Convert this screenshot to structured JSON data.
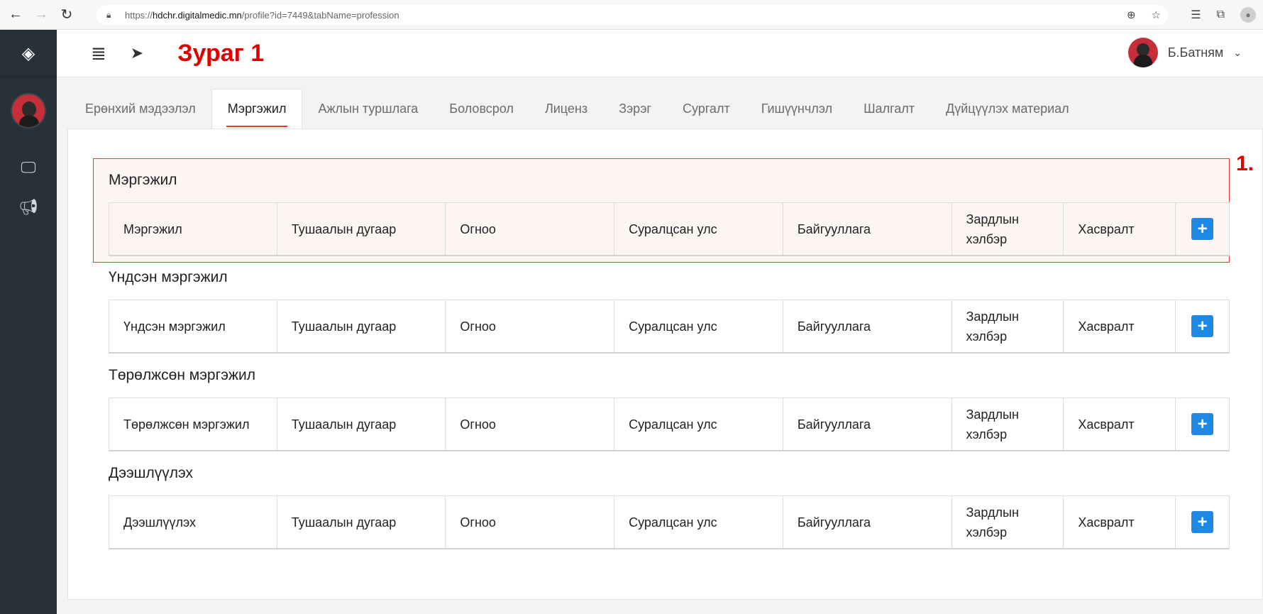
{
  "browser": {
    "url_scheme": "https://",
    "url_host": "hdchr.digitalmedic.mn",
    "url_path": "/profile?id=7449&tabName=profession"
  },
  "header": {
    "figure_title": "Зураг 1",
    "user_name": "Б.Батням"
  },
  "tabs": [
    {
      "label": "Ерөнхий мэдээлэл",
      "active": false
    },
    {
      "label": "Мэргэжил",
      "active": true
    },
    {
      "label": "Ажлын туршлага",
      "active": false
    },
    {
      "label": "Боловсрол",
      "active": false
    },
    {
      "label": "Лиценз",
      "active": false
    },
    {
      "label": "Зэрэг",
      "active": false
    },
    {
      "label": "Сургалт",
      "active": false
    },
    {
      "label": "Гишүүнчлэл",
      "active": false
    },
    {
      "label": "Шалгалт",
      "active": false
    },
    {
      "label": "Дүйцүүлэх материал",
      "active": false
    }
  ],
  "annotation": {
    "number": "1."
  },
  "sections": [
    {
      "title": "Мэргэжил",
      "columns": [
        "Мэргэжил",
        "Тушаалын дугаар",
        "Огноо",
        "Суралцсан улс",
        "Байгууллага",
        "Зардлын хэлбэр",
        "Хасвралт"
      ],
      "add_label": "+"
    },
    {
      "title": "Үндсэн мэргэжил",
      "columns": [
        "Үндсэн мэргэжил",
        "Тушаалын дугаар",
        "Огноо",
        "Суралцсан улс",
        "Байгууллага",
        "Зардлын хэлбэр",
        "Хасвралт"
      ],
      "add_label": "+"
    },
    {
      "title": "Төрөлжсөн мэргэжил",
      "columns": [
        "Төрөлжсөн мэргэжил",
        "Тушаалын дугаар",
        "Огноо",
        "Суралцсан улс",
        "Байгууллага",
        "Зардлын хэлбэр",
        "Хасвралт"
      ],
      "add_label": "+"
    },
    {
      "title": "Дээшлүүлэх",
      "columns": [
        "Дээшлүүлэх",
        "Тушаалын дугаар",
        "Огноо",
        "Суралцсан улс",
        "Байгууллага",
        "Зардлын хэлбэр",
        "Хасвралт"
      ],
      "add_label": "+"
    }
  ]
}
